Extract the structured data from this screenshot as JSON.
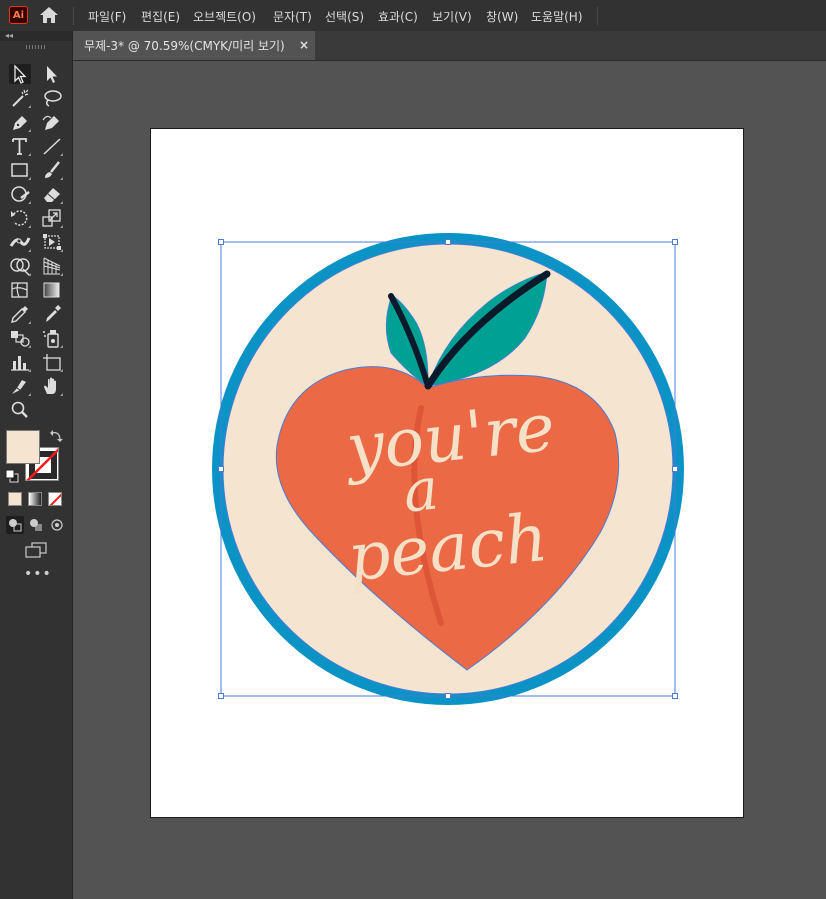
{
  "app": {
    "logo_text": "Ai",
    "home_icon": "home-icon",
    "menus": [
      "파일(F)",
      "편집(E)",
      "오브젝트(O)",
      "문자(T)",
      "선택(S)",
      "효과(C)",
      "보기(V)",
      "창(W)",
      "도움말(H)"
    ]
  },
  "toolbar": {
    "tools": [
      "selection-tool-icon",
      "direct-selection-tool-icon",
      "magic-wand-tool-icon",
      "lasso-tool-icon",
      "pen-tool-icon",
      "curvature-tool-icon",
      "type-tool-icon",
      "line-segment-tool-icon",
      "rectangle-tool-icon",
      "paintbrush-tool-icon",
      "shaper-tool-icon",
      "eraser-tool-icon",
      "rotate-tool-icon",
      "scale-tool-icon",
      "width-tool-icon",
      "free-transform-tool-icon",
      "shape-builder-tool-icon",
      "perspective-grid-tool-icon",
      "mesh-tool-icon",
      "gradient-tool-icon",
      "eyedropper-tool-icon",
      "eyedropper-alt-tool-icon",
      "blend-tool-icon",
      "symbol-sprayer-tool-icon",
      "column-graph-tool-icon",
      "artboard-tool-icon",
      "slice-tool-icon",
      "hand-tool-icon",
      "zoom-tool-icon"
    ],
    "more_label": "•••",
    "fill_color": "#f5e5d0",
    "stroke_color": "none"
  },
  "document": {
    "tab_title": "무제-3* @ 70.59%(CMYK/미리 보기)",
    "close_label": "×"
  },
  "artwork": {
    "text_line1": "you're",
    "text_line2": "a",
    "text_line3": "peach",
    "colors": {
      "ring": "#0b93c6",
      "background": "#f5e5d0",
      "peach": "#eb6a45",
      "leaf": "#01a095",
      "stem": "#0b1a2a",
      "lettering": "#f5e1c8",
      "selection": "#4a7bd6"
    }
  }
}
